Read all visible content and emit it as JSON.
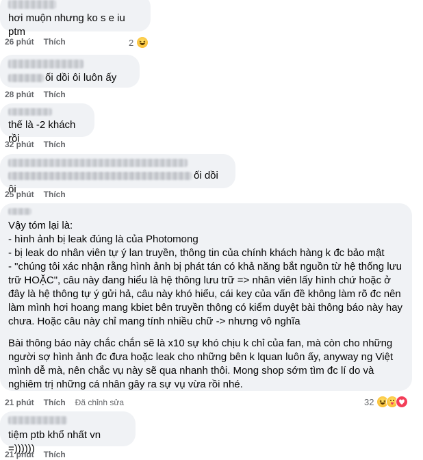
{
  "comments": [
    {
      "text": "hơi muộn nhưng ko s e iu ptm",
      "time": "26 phút",
      "like": "Thích",
      "reactions": {
        "count": "2",
        "icons": [
          "haha-icon"
        ]
      }
    },
    {
      "text": "ối dồi ôi luôn ấy",
      "time": "28 phút",
      "like": "Thích"
    },
    {
      "text": "thế là -2 khách rồi",
      "time": "32 phút",
      "like": "Thích"
    },
    {
      "text": "ối dồi ôi",
      "time": "25 phút",
      "like": "Thích"
    },
    {
      "lines": [
        "Vậy tóm lại là:",
        "- hình ảnh bị leak đúng là của Photomong",
        "- bị leak do nhân viên tự ý lan truyền, thông tin của chính khách hàng k đc bảo mật",
        "- \"chúng tôi xác nhận rằng hình ảnh bị phát tán có khả năng bắt nguồn từ hệ thống lưu trữ HOẶC\", câu này đang hiểu là hệ thông lưu trữ => nhân viên lấy hình chứ hoặc ở đây là hệ thông tự ý gửi hả, câu này khó hiểu, cái key của vấn đề không làm rõ đc nên làm mình hơi hoang mang kbiet bên truyền thông có kiểm duyệt bài thông báo này hay chưa. Hoặc câu này chỉ mang tính nhiều chữ -> nhưng vô nghĩa"
      ],
      "paragraph2": "Bài thông báo này chắc chắn sẽ là x10 sự khó chịu k chỉ của fan, mà còn cho những người sợ hình ảnh đc đưa hoặc leak cho những bên k lquan luôn ấy, anyway ng Việt mình dễ mà, nên chắc vụ này sẽ qua nhanh thôi. Mong shop sớm tìm đc lí do và nghiêm trị những cá nhân gây ra sự vụ vừa rồi nhé.",
      "time": "21 phút",
      "like": "Thích",
      "edited": "Đã chỉnh sửa",
      "reactions": {
        "count": "32",
        "icons": [
          "haha-icon",
          "care-icon",
          "love-icon"
        ]
      }
    },
    {
      "text": "tiệm ptb khổ nhất vn =))))))",
      "time": "21 phút",
      "like": "Thích"
    }
  ],
  "colors": {
    "bubble": "#f0f2f5",
    "meta": "#65676b",
    "text": "#050505"
  }
}
